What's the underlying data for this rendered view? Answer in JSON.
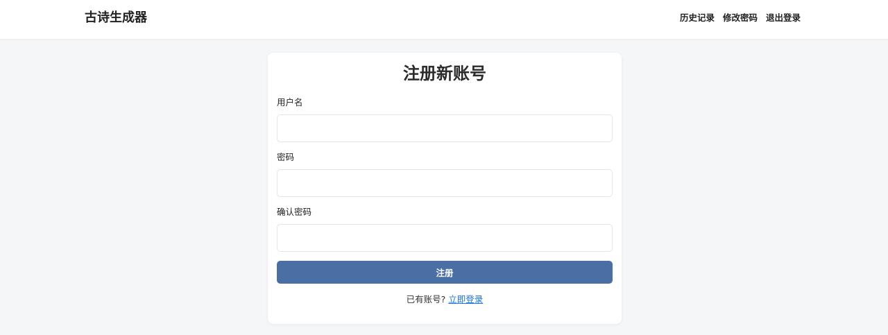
{
  "navbar": {
    "brand": "古诗生成器",
    "links": [
      "历史记录",
      "修改密码",
      "退出登录"
    ]
  },
  "form": {
    "title": "注册新账号",
    "username_label": "用户名",
    "username_value": "",
    "password_label": "密码",
    "password_value": "",
    "confirm_label": "确认密码",
    "confirm_value": "",
    "submit_label": "注册",
    "footer_text": "已有账号?",
    "login_link": "立即登录"
  },
  "colors": {
    "button": "#4a6fa5",
    "link": "#1a73e8",
    "background": "#f5f6f8"
  }
}
